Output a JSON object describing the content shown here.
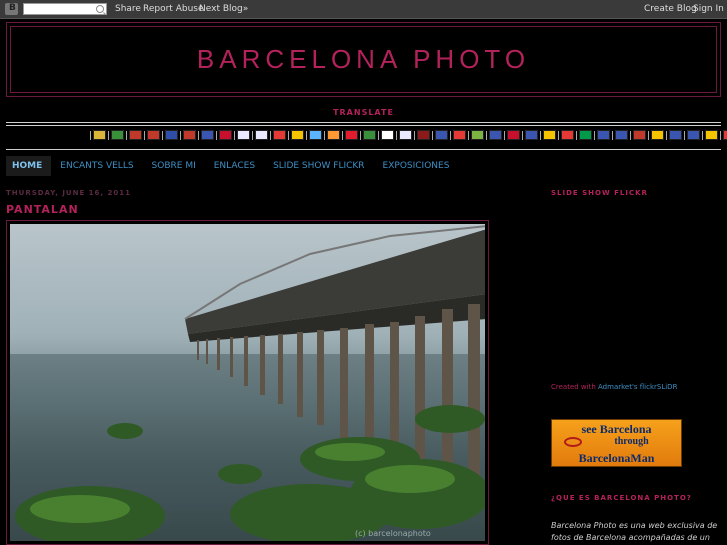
{
  "navbar": {
    "logo": "B",
    "share": "Share",
    "report_abuse": "Report Abuse",
    "next_blog": "Next Blog»",
    "create_blog": "Create Blog",
    "sign_in": "Sign In"
  },
  "header": {
    "title": "BARCELONA PHOTO"
  },
  "translate_label": "TRANSLATE",
  "flags": [
    "#d9b53a",
    "#3a8f3a",
    "#c0392b",
    "#c0392b",
    "#2e4ea8",
    "#c0392b",
    "#3a56b0",
    "#c8102e",
    "#e9e9ff",
    "#e9e9ff",
    "#e53935",
    "#f5c400",
    "#5cb3ff",
    "#ff9933",
    "#e21b2f",
    "#3a8f3a",
    "#ffffff",
    "#e9e9ff",
    "#8b1a1a",
    "#3a56b0",
    "#e53935",
    "#7cb342",
    "#3a56b0",
    "#c8102e",
    "#3a56b0",
    "#f5c400",
    "#e53935",
    "#009a49",
    "#3a56b0",
    "#3a56b0",
    "#c0392b",
    "#f5c400",
    "#3a56b0",
    "#3a56b0",
    "#f5c400",
    "#e53935"
  ],
  "tabs": [
    "HOME",
    "ENCANTS VELLS",
    "SOBRE MI",
    "ENLACES",
    "SLIDE SHOW FLICKR",
    "EXPOSICIONES"
  ],
  "post": {
    "date": "Thursday, June 16, 2011",
    "title": "PANTALAN",
    "watermark": "(c) barcelonaphoto"
  },
  "sidebar": {
    "slideshow_title": "SLIDE SHOW FLICKR",
    "credit_prefix": "Created with",
    "credit_link": "Admarket's flickrSLiDR",
    "banner": {
      "line1": "see Barcelona",
      "line2": "through",
      "line3": "BarcelonaMan"
    },
    "que_es_title": "¿QUE ES BARCELONA PHOTO?",
    "description": "Barcelona Photo es una web exclusiva de fotos de Barcelona acompañadas de un"
  },
  "colors": {
    "accent": "#b3225a",
    "link": "#3e8fc3",
    "background": "#000000"
  }
}
